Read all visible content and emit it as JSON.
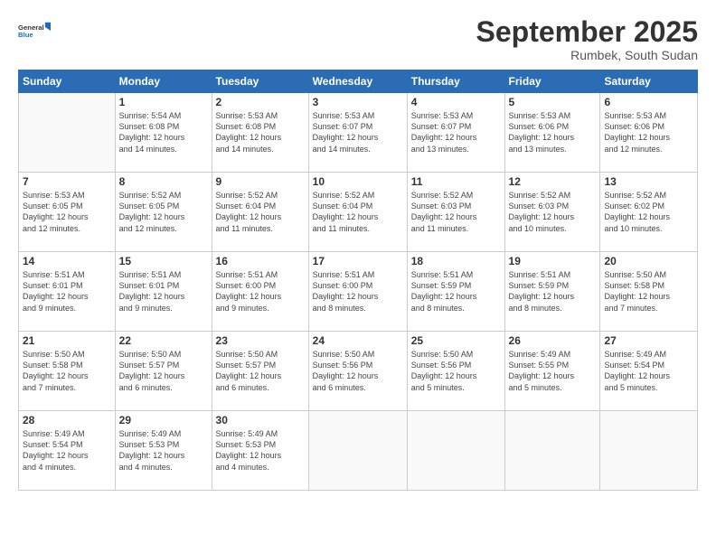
{
  "logo": {
    "line1": "General",
    "line2": "Blue"
  },
  "title": "September 2025",
  "subtitle": "Rumbek, South Sudan",
  "days_of_week": [
    "Sunday",
    "Monday",
    "Tuesday",
    "Wednesday",
    "Thursday",
    "Friday",
    "Saturday"
  ],
  "weeks": [
    [
      {
        "num": "",
        "info": ""
      },
      {
        "num": "1",
        "info": "Sunrise: 5:54 AM\nSunset: 6:08 PM\nDaylight: 12 hours\nand 14 minutes."
      },
      {
        "num": "2",
        "info": "Sunrise: 5:53 AM\nSunset: 6:08 PM\nDaylight: 12 hours\nand 14 minutes."
      },
      {
        "num": "3",
        "info": "Sunrise: 5:53 AM\nSunset: 6:07 PM\nDaylight: 12 hours\nand 14 minutes."
      },
      {
        "num": "4",
        "info": "Sunrise: 5:53 AM\nSunset: 6:07 PM\nDaylight: 12 hours\nand 13 minutes."
      },
      {
        "num": "5",
        "info": "Sunrise: 5:53 AM\nSunset: 6:06 PM\nDaylight: 12 hours\nand 13 minutes."
      },
      {
        "num": "6",
        "info": "Sunrise: 5:53 AM\nSunset: 6:06 PM\nDaylight: 12 hours\nand 12 minutes."
      }
    ],
    [
      {
        "num": "7",
        "info": "Sunrise: 5:53 AM\nSunset: 6:05 PM\nDaylight: 12 hours\nand 12 minutes."
      },
      {
        "num": "8",
        "info": "Sunrise: 5:52 AM\nSunset: 6:05 PM\nDaylight: 12 hours\nand 12 minutes."
      },
      {
        "num": "9",
        "info": "Sunrise: 5:52 AM\nSunset: 6:04 PM\nDaylight: 12 hours\nand 11 minutes."
      },
      {
        "num": "10",
        "info": "Sunrise: 5:52 AM\nSunset: 6:04 PM\nDaylight: 12 hours\nand 11 minutes."
      },
      {
        "num": "11",
        "info": "Sunrise: 5:52 AM\nSunset: 6:03 PM\nDaylight: 12 hours\nand 11 minutes."
      },
      {
        "num": "12",
        "info": "Sunrise: 5:52 AM\nSunset: 6:03 PM\nDaylight: 12 hours\nand 10 minutes."
      },
      {
        "num": "13",
        "info": "Sunrise: 5:52 AM\nSunset: 6:02 PM\nDaylight: 12 hours\nand 10 minutes."
      }
    ],
    [
      {
        "num": "14",
        "info": "Sunrise: 5:51 AM\nSunset: 6:01 PM\nDaylight: 12 hours\nand 9 minutes."
      },
      {
        "num": "15",
        "info": "Sunrise: 5:51 AM\nSunset: 6:01 PM\nDaylight: 12 hours\nand 9 minutes."
      },
      {
        "num": "16",
        "info": "Sunrise: 5:51 AM\nSunset: 6:00 PM\nDaylight: 12 hours\nand 9 minutes."
      },
      {
        "num": "17",
        "info": "Sunrise: 5:51 AM\nSunset: 6:00 PM\nDaylight: 12 hours\nand 8 minutes."
      },
      {
        "num": "18",
        "info": "Sunrise: 5:51 AM\nSunset: 5:59 PM\nDaylight: 12 hours\nand 8 minutes."
      },
      {
        "num": "19",
        "info": "Sunrise: 5:51 AM\nSunset: 5:59 PM\nDaylight: 12 hours\nand 8 minutes."
      },
      {
        "num": "20",
        "info": "Sunrise: 5:50 AM\nSunset: 5:58 PM\nDaylight: 12 hours\nand 7 minutes."
      }
    ],
    [
      {
        "num": "21",
        "info": "Sunrise: 5:50 AM\nSunset: 5:58 PM\nDaylight: 12 hours\nand 7 minutes."
      },
      {
        "num": "22",
        "info": "Sunrise: 5:50 AM\nSunset: 5:57 PM\nDaylight: 12 hours\nand 6 minutes."
      },
      {
        "num": "23",
        "info": "Sunrise: 5:50 AM\nSunset: 5:57 PM\nDaylight: 12 hours\nand 6 minutes."
      },
      {
        "num": "24",
        "info": "Sunrise: 5:50 AM\nSunset: 5:56 PM\nDaylight: 12 hours\nand 6 minutes."
      },
      {
        "num": "25",
        "info": "Sunrise: 5:50 AM\nSunset: 5:56 PM\nDaylight: 12 hours\nand 5 minutes."
      },
      {
        "num": "26",
        "info": "Sunrise: 5:49 AM\nSunset: 5:55 PM\nDaylight: 12 hours\nand 5 minutes."
      },
      {
        "num": "27",
        "info": "Sunrise: 5:49 AM\nSunset: 5:54 PM\nDaylight: 12 hours\nand 5 minutes."
      }
    ],
    [
      {
        "num": "28",
        "info": "Sunrise: 5:49 AM\nSunset: 5:54 PM\nDaylight: 12 hours\nand 4 minutes."
      },
      {
        "num": "29",
        "info": "Sunrise: 5:49 AM\nSunset: 5:53 PM\nDaylight: 12 hours\nand 4 minutes."
      },
      {
        "num": "30",
        "info": "Sunrise: 5:49 AM\nSunset: 5:53 PM\nDaylight: 12 hours\nand 4 minutes."
      },
      {
        "num": "",
        "info": ""
      },
      {
        "num": "",
        "info": ""
      },
      {
        "num": "",
        "info": ""
      },
      {
        "num": "",
        "info": ""
      }
    ]
  ]
}
